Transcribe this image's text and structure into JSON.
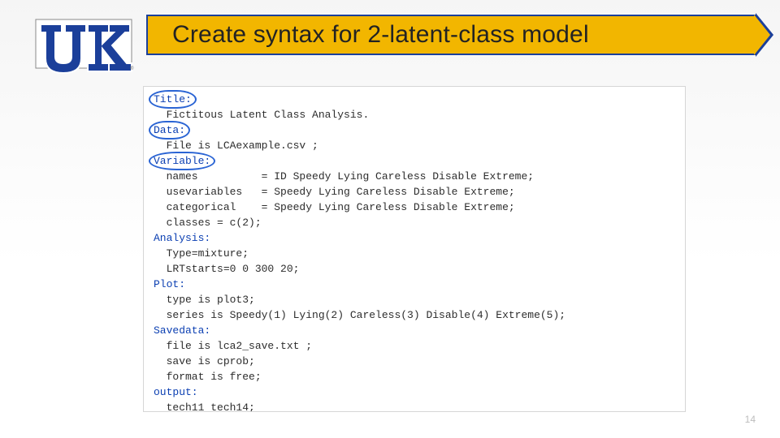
{
  "slide": {
    "title": "Create syntax for 2-latent-class model",
    "page_number": "14"
  },
  "logo": {
    "alt": "UK (University of Kentucky) logo",
    "primary": "#1b3f9a",
    "accent": "#ffffff"
  },
  "code": {
    "sections": [
      {
        "kw": "Title:",
        "circled": true,
        "lines": [
          "  Fictitous Latent Class Analysis."
        ]
      },
      {
        "kw": "Data:",
        "circled": true,
        "lines": [
          "  File is LCAexample.csv ;"
        ]
      },
      {
        "kw": "Variable:",
        "circled": true,
        "lines": [
          "  names          = ID Speedy Lying Careless Disable Extreme;",
          "  usevariables   = Speedy Lying Careless Disable Extreme;",
          "  categorical    = Speedy Lying Careless Disable Extreme;",
          "  classes = c(2);"
        ]
      },
      {
        "kw": "Analysis:",
        "circled": false,
        "lines": [
          "  Type=mixture;",
          "  LRTstarts=0 0 300 20;"
        ]
      },
      {
        "kw": "Plot:",
        "circled": false,
        "lines": [
          "  type is plot3;",
          "  series is Speedy(1) Lying(2) Careless(3) Disable(4) Extreme(5);"
        ]
      },
      {
        "kw": "Savedata:",
        "circled": false,
        "lines": [
          "  file is lca2_save.txt ;",
          "  save is cprob;",
          "  format is free;"
        ]
      },
      {
        "kw": "output:",
        "circled": false,
        "lines": [
          "  tech11 tech14;"
        ]
      }
    ]
  }
}
